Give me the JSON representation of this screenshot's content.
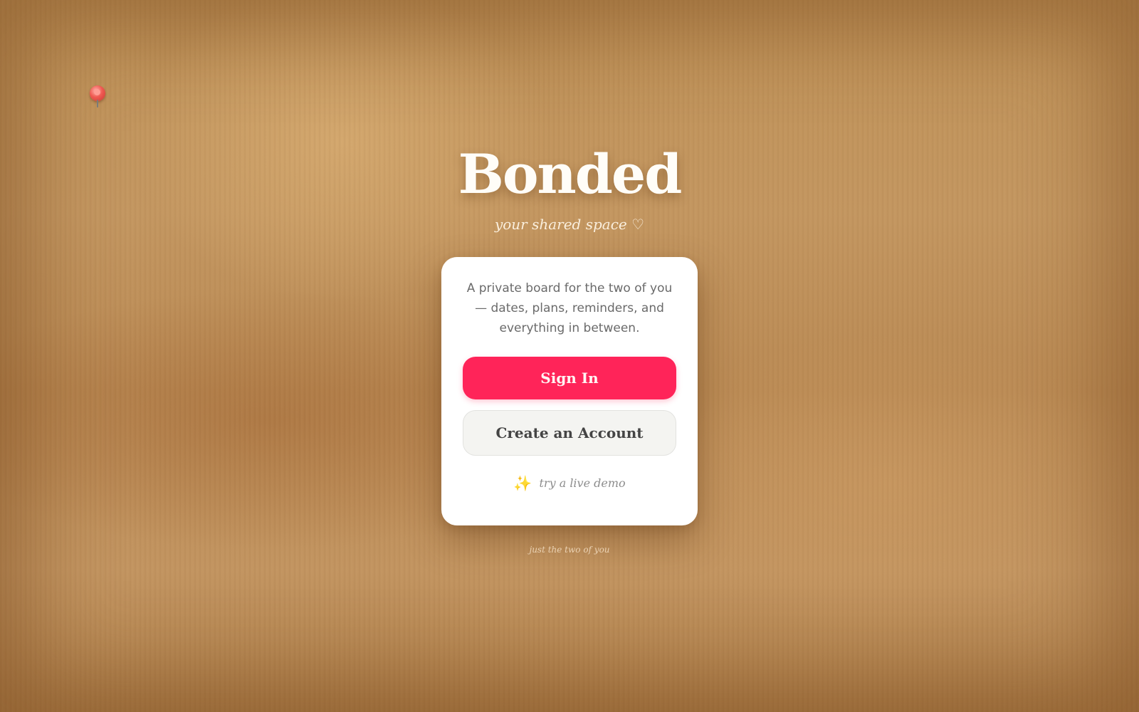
{
  "brand": {
    "title": "Bonded",
    "tagline": "your shared space ♡"
  },
  "card": {
    "description": "A private board for the two of you — dates, plans, reminders, and everything in between.",
    "sign_in_label": "Sign In",
    "create_account_label": "Create an Account",
    "demo_label": "try a live demo",
    "demo_icon": "sparkles-icon"
  },
  "footer": {
    "note": "just the two of you"
  },
  "decor": {
    "pin_icon": "pushpin-icon"
  },
  "colors": {
    "primary": "#ff2459",
    "board": "#c39660",
    "card": "#ffffff",
    "secondary_button": "#f4f4f1"
  }
}
